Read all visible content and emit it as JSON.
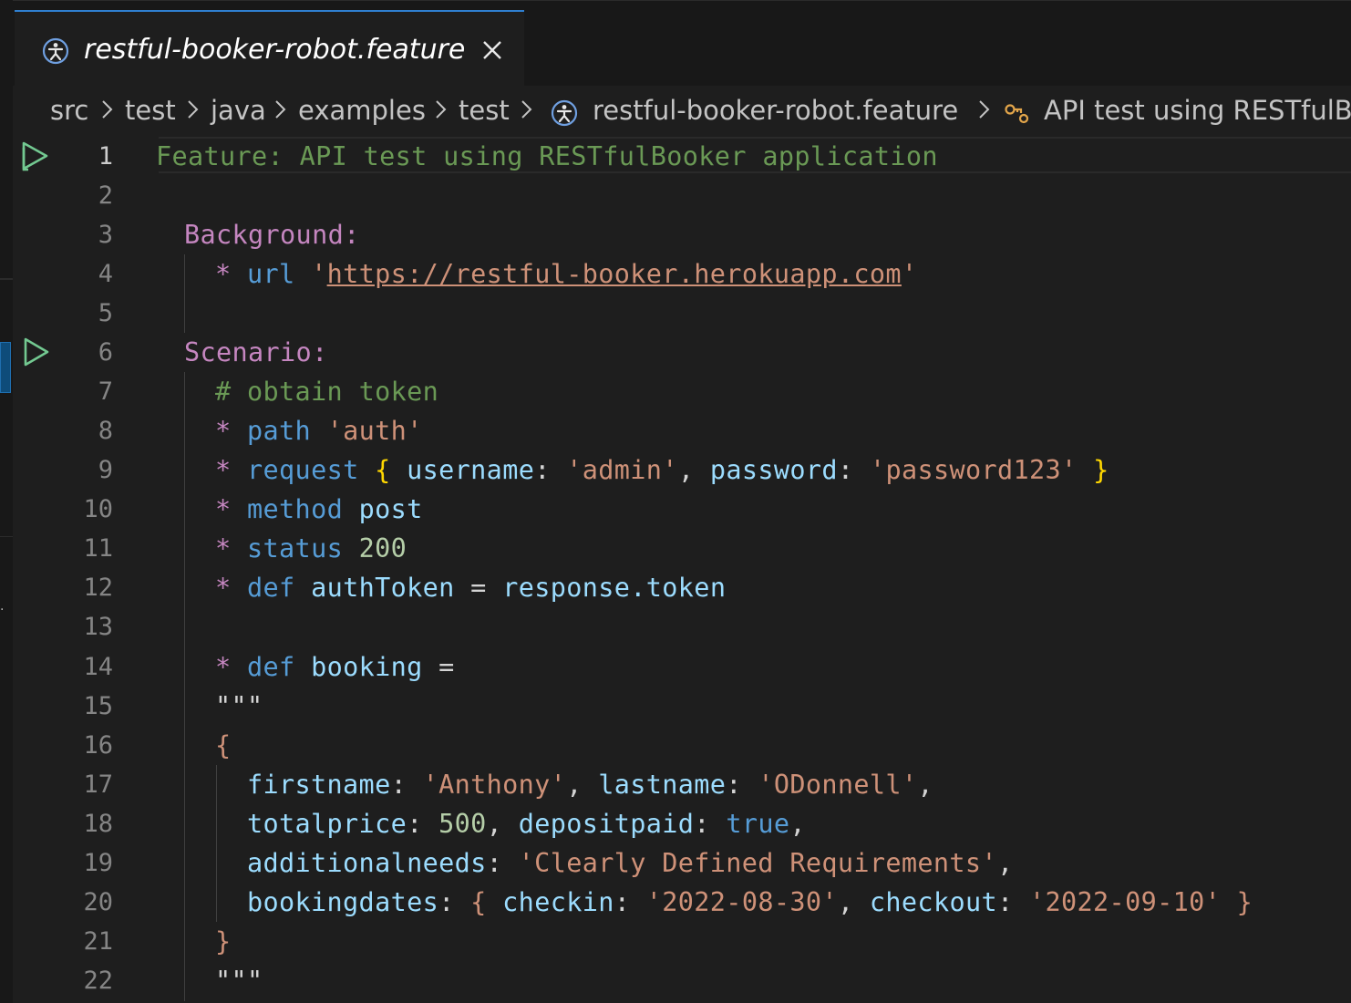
{
  "tab": {
    "title": "restful-booker-robot.feature",
    "icon": "karate-icon",
    "close_icon": "close-icon"
  },
  "breadcrumb": {
    "items": [
      "src",
      "test",
      "java",
      "examples",
      "test",
      "restful-booker-robot.feature",
      "API test using RESTfulB"
    ],
    "file_icon": "karate-icon",
    "symbol_icon": "symbol-key-icon"
  },
  "editor": {
    "current_line": 1,
    "line_numbers": [
      "1",
      "2",
      "3",
      "4",
      "5",
      "6",
      "7",
      "8",
      "9",
      "10",
      "11",
      "12",
      "13",
      "14",
      "15",
      "16",
      "17",
      "18",
      "19",
      "20",
      "21",
      "22"
    ],
    "run_glyph_lines": [
      1,
      6
    ],
    "lines": {
      "l1": {
        "kw": "Feature:",
        "rest": " API test using RESTfulBooker application"
      },
      "l3": {
        "kw": "Background:"
      },
      "l4": {
        "star": "*",
        "step": "url",
        "q1": "'",
        "url": "https://restful-booker.herokuapp.com",
        "q2": "'"
      },
      "l6": {
        "kw": "Scenario:"
      },
      "l7": {
        "comment": "# obtain token"
      },
      "l8": {
        "star": "*",
        "step": "path",
        "str": "'auth'"
      },
      "l9": {
        "star": "*",
        "step": "request",
        "b1": "{",
        "k1": "username",
        "c1": ":",
        "v1": "'admin'",
        "comma": ",",
        "k2": "password",
        "c2": ":",
        "v2": "'password123'",
        "b2": "}"
      },
      "l10": {
        "star": "*",
        "step": "method",
        "val": "post"
      },
      "l11": {
        "star": "*",
        "step": "status",
        "val": "200"
      },
      "l12": {
        "star": "*",
        "step": "def",
        "var": "authToken",
        "eq": "=",
        "expr": "response.token"
      },
      "l14": {
        "star": "*",
        "step": "def",
        "var": "booking",
        "eq": "="
      },
      "l15": {
        "text": "\"\"\""
      },
      "l16": {
        "text": "{"
      },
      "l17": {
        "k1": "firstname",
        "c1": ":",
        "v1": "'Anthony'",
        "comma": ",",
        "k2": "lastname",
        "c2": ":",
        "v2": "'ODonnell'",
        "end": ","
      },
      "l18": {
        "k1": "totalprice",
        "c1": ":",
        "v1": "500",
        "comma": ",",
        "k2": "depositpaid",
        "c2": ":",
        "v2": "true",
        "end": ","
      },
      "l19": {
        "k1": "additionalneeds",
        "c1": ":",
        "v1": "'Clearly Defined Requirements'",
        "end": ","
      },
      "l20": {
        "k1": "bookingdates",
        "c1": ":",
        "b1": "{",
        "k2": "checkin",
        "c2": ":",
        "v2": "'2022-08-30'",
        "comma": ",",
        "k3": "checkout",
        "c3": ":",
        "v3": "'2022-09-10'",
        "b2": "}"
      },
      "l21": {
        "text": "}"
      },
      "l22": {
        "text": "\"\"\""
      }
    }
  },
  "colors": {
    "tab_accent": "#2f7fd0",
    "keyword_green": "#6a9955",
    "keyword_purple": "#c586c0",
    "step_blue": "#569cd6",
    "property": "#9cdcfe",
    "string": "#ce9178",
    "number": "#b5cea8",
    "run_glyph": "#73c991"
  }
}
